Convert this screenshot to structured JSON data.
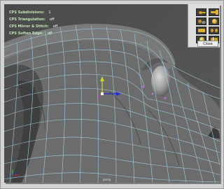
{
  "hud": {
    "rows": [
      {
        "label": "CPS Subdivisions:",
        "value": "1"
      },
      {
        "label": "CPS Triangulation:",
        "value": "off"
      },
      {
        "label": "CPS Mirror & Stitch:",
        "value": "off"
      },
      {
        "label": "CPS Soften Edge:",
        "value": "off"
      }
    ]
  },
  "shelf": {
    "close_label": "Close",
    "tools": [
      {
        "icon": "key-icon"
      },
      {
        "icon": "move-arrow-icon"
      },
      {
        "icon": "split-tool-icon"
      },
      {
        "icon": "sphere-icon"
      },
      {
        "icon": "extrude-tool-icon"
      },
      {
        "icon": "merge-tool-icon"
      },
      {
        "icon": "smooth-sphere-icon"
      },
      {
        "icon": "cut-face-icon"
      }
    ]
  },
  "viewport": {
    "status_text": "persp"
  },
  "colors": {
    "mesh_face": "#6e6e6e",
    "wire": "#9fcfe0",
    "hud_text": "#bfe6b0",
    "axis_x": "#2a2ad6",
    "axis_y": "#d6d62a",
    "axis_z": "#d62ad6"
  }
}
